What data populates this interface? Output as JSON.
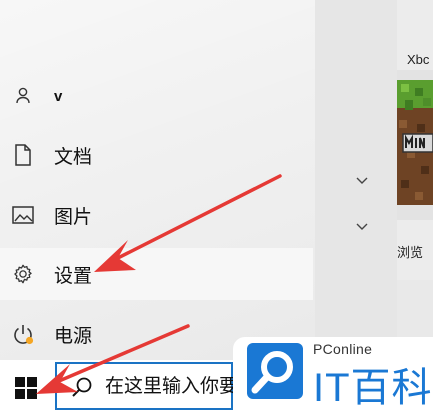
{
  "start_menu": {
    "user": {
      "label": "v",
      "icon": "user-icon"
    },
    "items": [
      {
        "label": "文档",
        "icon": "document-icon"
      },
      {
        "label": "图片",
        "icon": "pictures-icon"
      },
      {
        "label": "设置",
        "icon": "gear-icon"
      },
      {
        "label": "电源",
        "icon": "power-icon"
      }
    ]
  },
  "tiles": {
    "xbox_label": "Xbc",
    "browse_label": "浏览"
  },
  "taskbar": {
    "start_icon": "windows-logo-icon",
    "search": {
      "placeholder": "在这里输入你要",
      "icon": "search-icon"
    }
  },
  "watermark": {
    "brand_small": "PConline",
    "brand_large": "IT百科"
  },
  "colors": {
    "arrow": "#e53935",
    "accent": "#1a73c4",
    "brand_blue": "#1a78d4"
  }
}
